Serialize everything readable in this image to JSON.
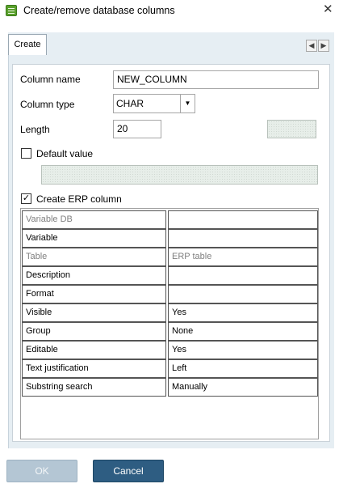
{
  "window": {
    "title": "Create/remove database columns",
    "close_glyph": "✕",
    "icon": "database-table-icon"
  },
  "tabs": [
    {
      "label": "Create",
      "active": true
    }
  ],
  "tab_scroll": {
    "left_glyph": "◀",
    "right_glyph": "▶"
  },
  "form": {
    "column_name_label": "Column name",
    "column_name_value": "NEW_COLUMN",
    "column_type_label": "Column type",
    "column_type_value": "CHAR",
    "dropdown_glyph": "▼",
    "length_label": "Length",
    "length_value": "20",
    "default_value_label": "Default value",
    "default_value_checked": false,
    "create_erp_label": "Create ERP column",
    "create_erp_checked": true,
    "check_glyph": "✓"
  },
  "erp_table": {
    "rows": [
      {
        "name": "Variable DB",
        "value": "",
        "name_greyed": true,
        "value_greyed": false
      },
      {
        "name": "Variable",
        "value": "",
        "name_greyed": false,
        "value_greyed": false
      },
      {
        "name": "Table",
        "value": "ERP table",
        "name_greyed": true,
        "value_greyed": true
      },
      {
        "name": "Description",
        "value": "",
        "name_greyed": false,
        "value_greyed": false
      },
      {
        "name": "Format",
        "value": "",
        "name_greyed": false,
        "value_greyed": false
      },
      {
        "name": "Visible",
        "value": "Yes",
        "name_greyed": false,
        "value_greyed": false
      },
      {
        "name": "Group",
        "value": "None",
        "name_greyed": false,
        "value_greyed": false
      },
      {
        "name": "Editable",
        "value": "Yes",
        "name_greyed": false,
        "value_greyed": false
      },
      {
        "name": "Text justification",
        "value": "Left",
        "name_greyed": false,
        "value_greyed": false
      },
      {
        "name": "Substring search",
        "value": "Manually",
        "name_greyed": false,
        "value_greyed": false
      }
    ]
  },
  "buttons": {
    "ok_label": "OK",
    "ok_enabled": false,
    "cancel_label": "Cancel"
  },
  "colors": {
    "accent": "#2e5d82",
    "disabled_button": "#b4c6d4",
    "panel_background": "#e6eef3",
    "greyed_text": "#808080"
  }
}
